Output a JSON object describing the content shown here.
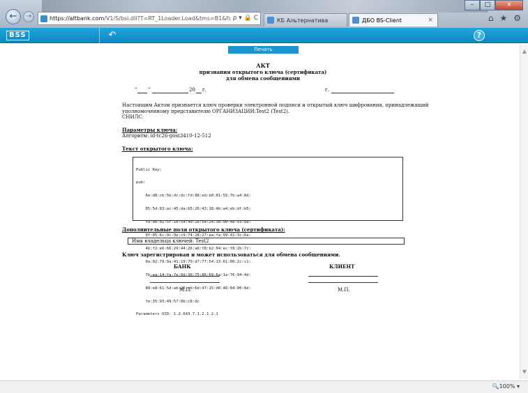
{
  "browser": {
    "address_host": "https://altbank.com",
    "address_path": "/V1/S/bsi.dll?T=RT_1Loader.Load&tms=B1&fqgbq",
    "address_tools": "ρ ▾ 🔒 C",
    "tabs": [
      {
        "label": "КБ Альтернатива"
      },
      {
        "label": "ДБО BS-Client",
        "close": "×"
      }
    ],
    "back_glyph": "←",
    "forward_glyph": "→",
    "window_buttons": {
      "minimize": "–",
      "maximize": "□",
      "close": "×"
    },
    "toolbar_icons": {
      "home": "⌂",
      "favorites": "★",
      "settings": "⚙"
    },
    "zoom": "🔍100%  ▾"
  },
  "app_header": {
    "logo": "BSS",
    "back_icon": "↶",
    "help_icon": "?",
    "accent_color": "#1a9ad6"
  },
  "document": {
    "print_button": "Печать",
    "title": "АКТ",
    "subtitle_1": "признания открытого ключа (сертификата)",
    "subtitle_2": "для обмена сообщениями",
    "date_quote_open": "\"",
    "date_quote_close": "\"",
    "date_year": "20",
    "date_suffix": "г.",
    "city_prefix": "г.",
    "intro_line_1": "Настоящим Актом признается ключ проверки электронной подписи и открытый ключ шифрования, принадлежащий",
    "intro_line_2": "уполномоченному представителю ОРГАНИЗАЦИИ:Test2 (Test2).",
    "intro_line_3": "СНИЛС:",
    "params_heading": "Параметры ключа:",
    "algorithm": "Алгоритм: id-tc26-gost3410-12-512",
    "pubkey_heading": "Текст открытого ключа:",
    "pubkey_lines": [
      "Public Key:",
      "pub:",
      "    6e:d8:cb:5b:dc:dc:fd:88:ed:b0:81:55:7b:a4:8d:",
      "    05:5d:83:ac:45:da:65:26:43:18:4b:a4:eb:df:b5:",
      "    f9:9b:01:5f:10:54:4d:2e:54:24:3d:90:4e:93:6d:",
      "    9f:05:6c:9c:9e:c9:74:28:27:ea:fa:99:41:3c:6a:",
      "    4b:f2:e6:66:29:44:26:a6:f8:b2:04:ec:f8:2b:7c:",
      "    0a:92:79:9a:41:19:79:d7:77:54:13:61:00:2c:c1:",
      "    7b:ea:14:fa:7e:9d:30:75:86:69:6a:1a:76:94:4d:",
      "    88:e8:61:5d:ab:26:cb:6d:47:15:d0:46:04:90:8d:",
      "    fe:35:93:49:57:8b:c8:dc",
      "Parameters OID: 1.2.643.7.1.2.1.2.1"
    ],
    "extra_heading": "Дополнительные поля открытого ключа (сертификата):",
    "owner_field": "Имя владельца ключей: Test2",
    "registered_text": "Ключ зарегистрирован и может использоваться для обмена сообщениями.",
    "bank_label": "БАНК",
    "client_label": "КЛИЕНТ",
    "stamp_label": "М.П."
  }
}
